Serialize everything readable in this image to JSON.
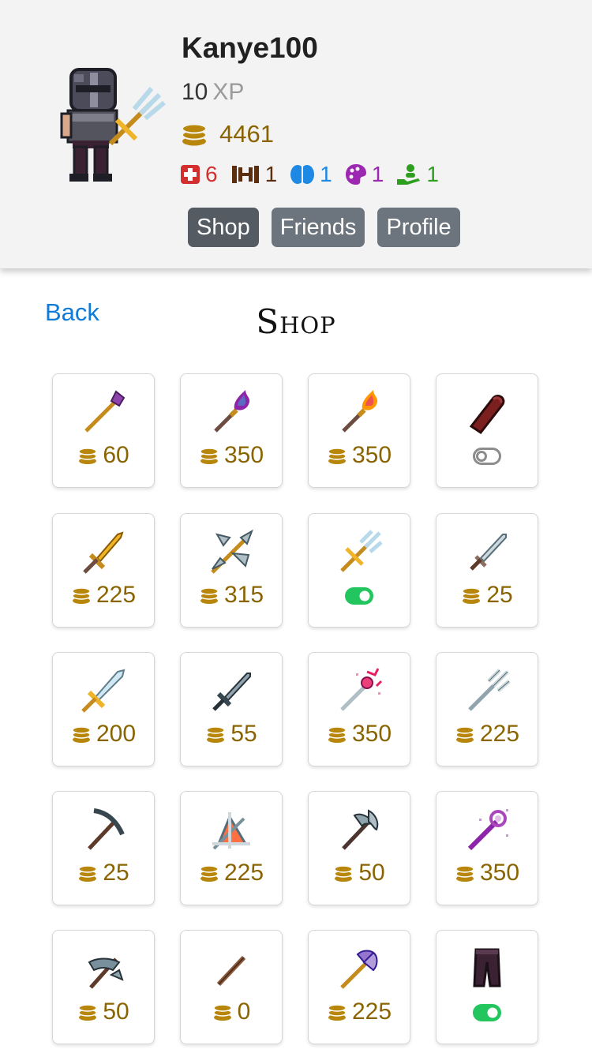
{
  "profile": {
    "username": "Kanye100",
    "xp_value": "10",
    "xp_unit": "XP",
    "coins": "4461",
    "stats": [
      {
        "icon": "health-cross-icon",
        "value": "6",
        "color": "#d32f2f"
      },
      {
        "icon": "dumbbell-icon",
        "value": "1",
        "color": "#5a2e0e"
      },
      {
        "icon": "brain-icon",
        "value": "1",
        "color": "#1e88e5"
      },
      {
        "icon": "palette-icon",
        "value": "1",
        "color": "#9c27b0"
      },
      {
        "icon": "hand-person-icon",
        "value": "1",
        "color": "#2e9e1f"
      }
    ]
  },
  "nav": {
    "shop": "Shop",
    "friends": "Friends",
    "profile": "Profile"
  },
  "page": {
    "back": "Back",
    "title": "Shop"
  },
  "items": [
    {
      "icon": "amethyst-staff-icon",
      "price": "60"
    },
    {
      "icon": "purple-flame-torch-icon",
      "price": "350"
    },
    {
      "icon": "fire-torch-icon",
      "price": "350"
    },
    {
      "icon": "leather-gauntlet-icon",
      "toggle": "off"
    },
    {
      "icon": "golden-sword-icon",
      "price": "225"
    },
    {
      "icon": "winged-axe-icon",
      "price": "315"
    },
    {
      "icon": "ice-trident-icon",
      "toggle": "on"
    },
    {
      "icon": "short-sword-icon",
      "price": "25"
    },
    {
      "icon": "crystal-sword-icon",
      "price": "200"
    },
    {
      "icon": "dark-sword-icon",
      "price": "55"
    },
    {
      "icon": "pink-magic-staff-icon",
      "price": "350"
    },
    {
      "icon": "silver-trident-icon",
      "price": "225"
    },
    {
      "icon": "pickaxe-icon",
      "price": "25"
    },
    {
      "icon": "crossbow-icon",
      "price": "225"
    },
    {
      "icon": "battle-axe-icon",
      "price": "50"
    },
    {
      "icon": "violet-scepter-icon",
      "price": "350"
    },
    {
      "icon": "halberd-icon",
      "price": "50"
    },
    {
      "icon": "wooden-stick-icon",
      "price": "0"
    },
    {
      "icon": "purple-double-axe-icon",
      "price": "225"
    },
    {
      "icon": "dark-pants-icon",
      "toggle": "on"
    }
  ]
}
